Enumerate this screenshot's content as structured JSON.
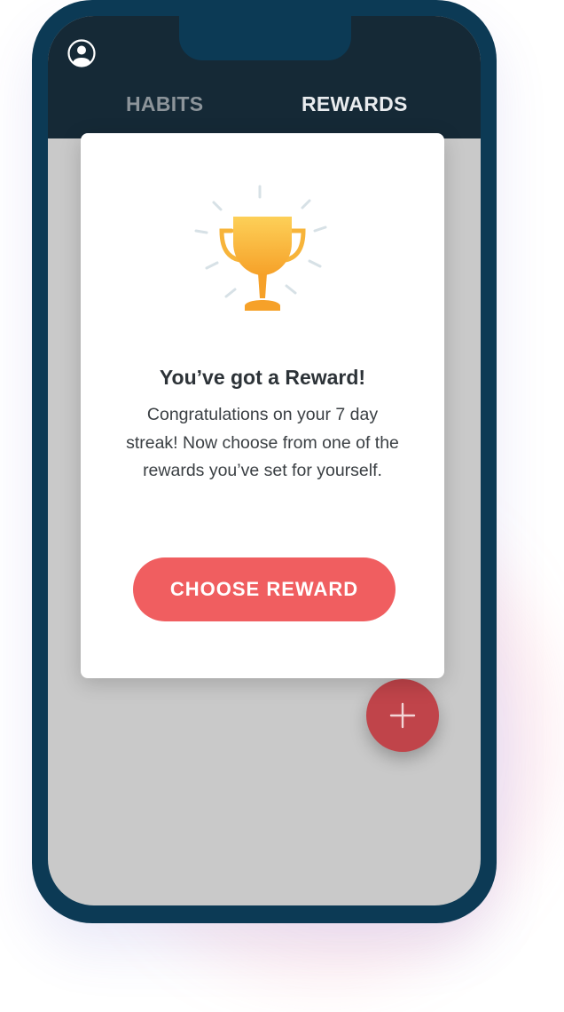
{
  "header": {
    "avatar_icon": "user-avatar-icon",
    "tabs": [
      {
        "label": "HABITS",
        "active": false
      },
      {
        "label": "REWARDS",
        "active": true
      }
    ]
  },
  "reward_modal": {
    "icon": "trophy-icon",
    "title": "You’ve got a Reward!",
    "message": "Congratulations on your 7 day streak! Now choose from one of the rewards you’ve set for yourself.",
    "button_label": "CHOOSE REWARD"
  },
  "fab": {
    "icon": "plus-icon"
  },
  "colors": {
    "phone_frame": "#0c3a55",
    "header_bg": "#152936",
    "screen_bg": "#c9c9c9",
    "accent": "#f05e60",
    "fab": "#c0444a",
    "trophy": "#f8b332"
  }
}
